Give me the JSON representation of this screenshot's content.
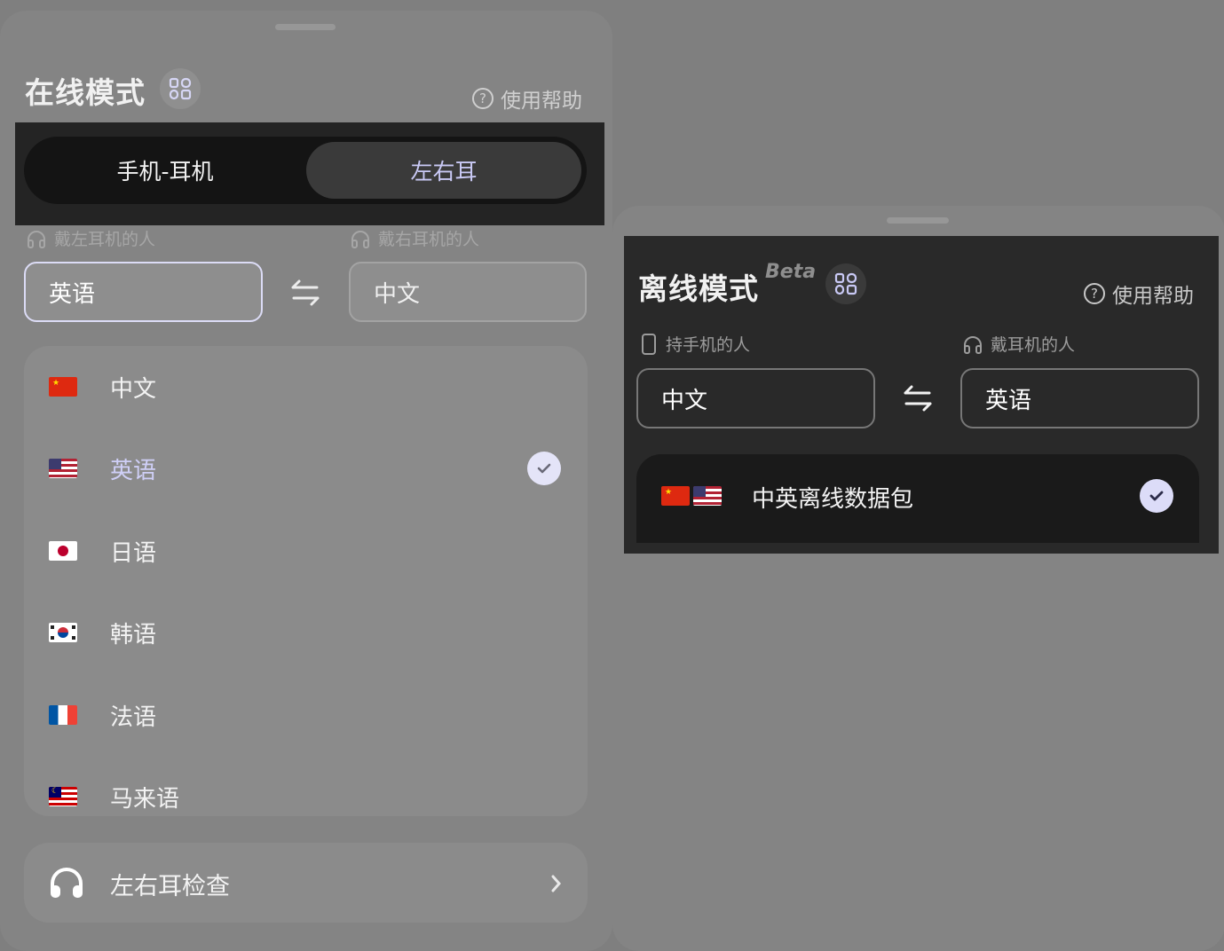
{
  "online": {
    "title": "在线模式",
    "help": "使用帮助",
    "tabs": [
      {
        "label": "手机-耳机"
      },
      {
        "label": "左右耳",
        "selected": true
      }
    ],
    "left_label": "戴左耳机的人",
    "right_label": "戴右耳机的人",
    "source_lang": "英语",
    "target_lang": "中文",
    "languages": [
      {
        "name": "中文",
        "flag": "cn-flag"
      },
      {
        "name": "英语",
        "flag": "us-flag",
        "selected": true
      },
      {
        "name": "日语",
        "flag": "jp-flag"
      },
      {
        "name": "韩语",
        "flag": "kr-flag"
      },
      {
        "name": "法语",
        "flag": "fr-flag"
      },
      {
        "name": "马来语",
        "flag": "my-flag"
      }
    ],
    "ear_check": "左右耳检查"
  },
  "offline": {
    "title": "离线模式",
    "beta": "Beta",
    "help": "使用帮助",
    "phone_label": "持手机的人",
    "ear_label": "戴耳机的人",
    "source_lang": "中文",
    "target_lang": "英语",
    "package": "中英离线数据包"
  },
  "colors": {
    "accent": "#c9c9f5",
    "check_bg": "#e4e4f8",
    "check_mark": "#2c2c4a"
  }
}
